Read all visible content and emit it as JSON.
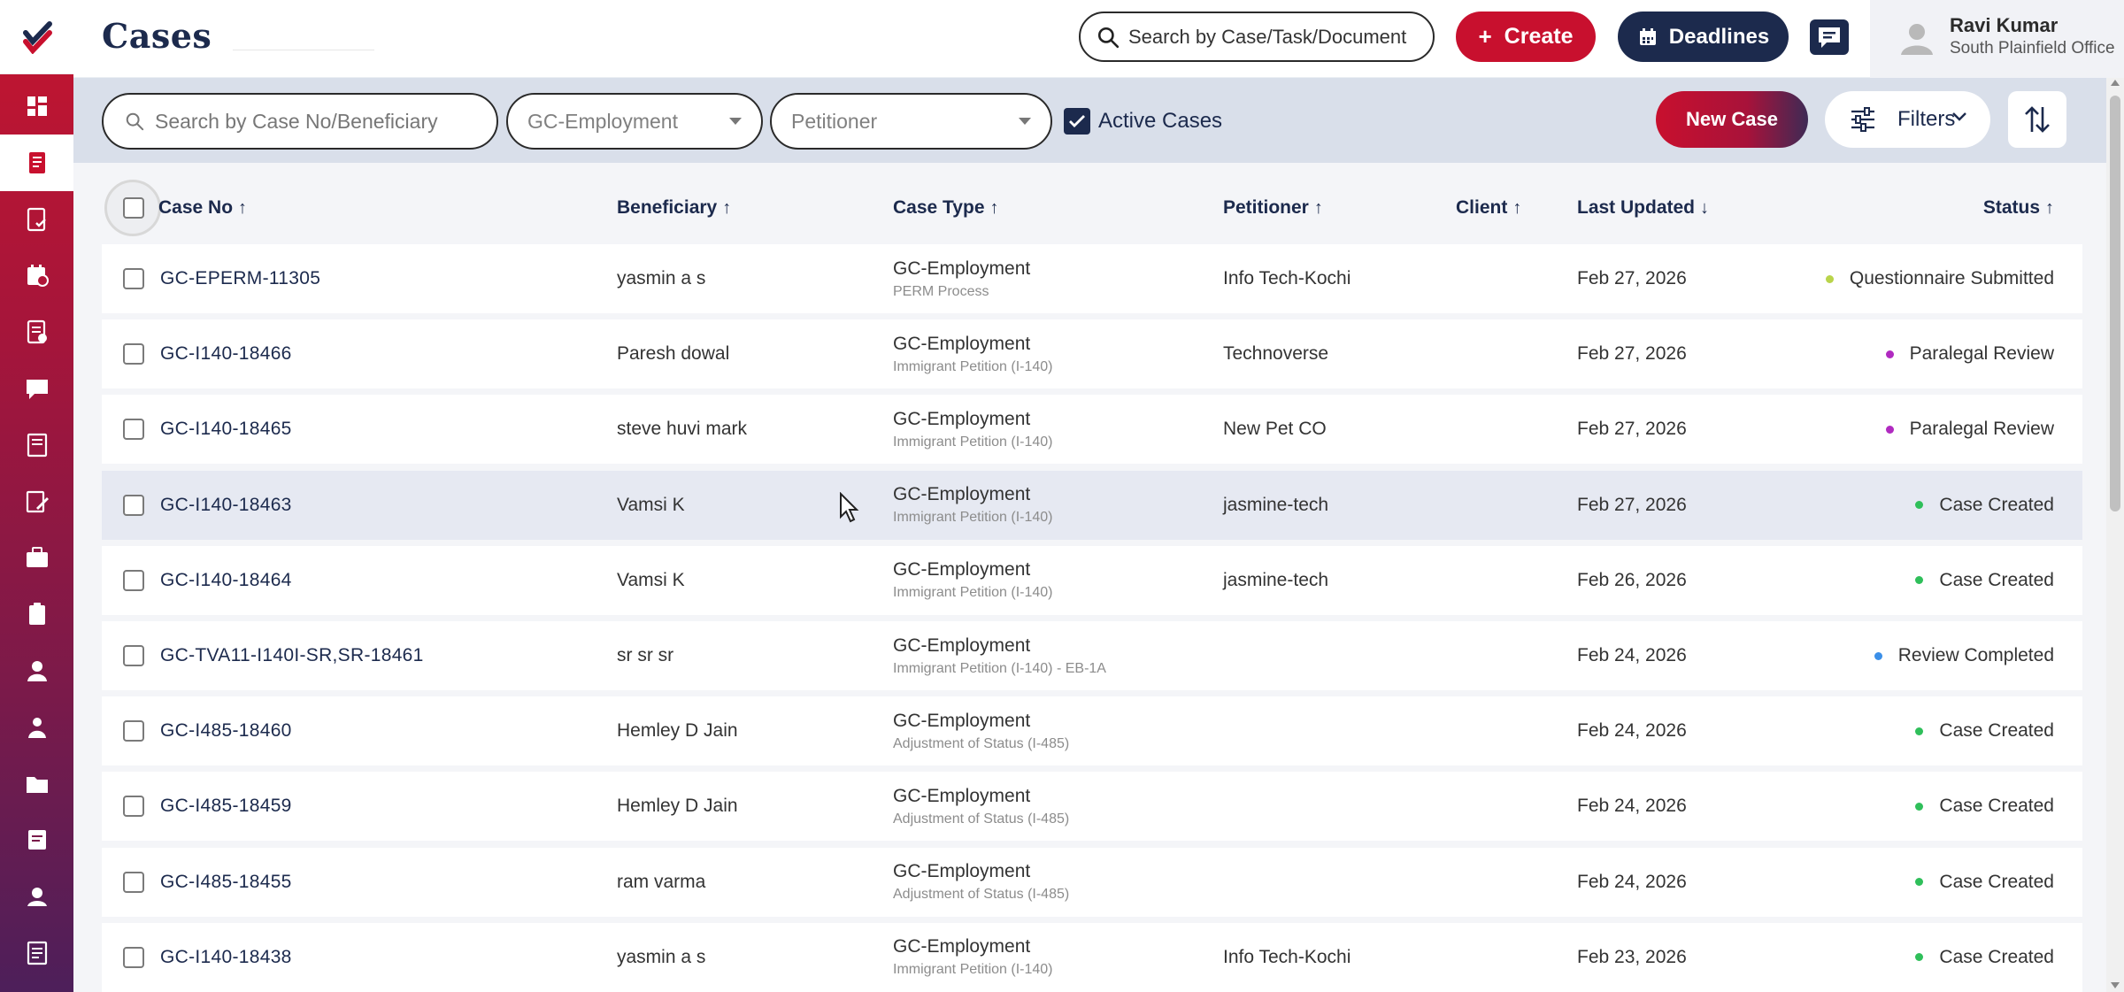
{
  "header": {
    "title": "Cases",
    "search_placeholder": "Search by Case/Task/Document",
    "create_label": "Create",
    "deadlines_label": "Deadlines",
    "user_name": "Ravi Kumar",
    "user_office": "South Plainfield Office"
  },
  "sidebar": {
    "items": [
      {
        "icon": "dashboard-icon"
      },
      {
        "icon": "cases-icon",
        "active": true
      },
      {
        "icon": "document-check-icon"
      },
      {
        "icon": "calendar-icon"
      },
      {
        "icon": "document-list-icon"
      },
      {
        "icon": "chat-icon"
      },
      {
        "icon": "book-icon"
      },
      {
        "icon": "edit-document-icon"
      },
      {
        "icon": "briefcase-icon"
      },
      {
        "icon": "clipboard-icon"
      },
      {
        "icon": "user-icon"
      },
      {
        "icon": "user-group-icon"
      },
      {
        "icon": "folder-icon"
      },
      {
        "icon": "notes-icon"
      },
      {
        "icon": "contact-icon"
      },
      {
        "icon": "reports-icon"
      }
    ]
  },
  "filters": {
    "search_placeholder": "Search by Case No/Beneficiary",
    "case_type_value": "GC-Employment",
    "petitioner_placeholder": "Petitioner",
    "active_cases_label": "Active Cases",
    "active_cases_checked": true,
    "new_case_label": "New Case",
    "filters_label": "Filters"
  },
  "table": {
    "columns": [
      {
        "label": "Case No",
        "sort": "↑"
      },
      {
        "label": "Beneficiary",
        "sort": "↑"
      },
      {
        "label": "Case Type",
        "sort": "↑"
      },
      {
        "label": "Petitioner",
        "sort": "↑"
      },
      {
        "label": "Client",
        "sort": "↑"
      },
      {
        "label": "Last Updated",
        "sort": "↓"
      },
      {
        "label": "Status",
        "sort": "↑"
      }
    ],
    "rows": [
      {
        "case_no": "GC-EPERM-11305",
        "beneficiary": "yasmin a s",
        "case_type": "GC-Employment",
        "case_subtype": "PERM Process",
        "petitioner": "Info Tech-Kochi",
        "client": "",
        "last_updated": "Feb 27, 2026",
        "status": "Questionnaire Submitted",
        "status_color": "#b9d44a"
      },
      {
        "case_no": "GC-I140-18466",
        "beneficiary": "Paresh dowal",
        "case_type": "GC-Employment",
        "case_subtype": "Immigrant Petition (I-140)",
        "petitioner": "Technoverse",
        "client": "",
        "last_updated": "Feb 27, 2026",
        "status": "Paralegal Review",
        "status_color": "#b02ac0"
      },
      {
        "case_no": "GC-I140-18465",
        "beneficiary": "steve huvi mark",
        "case_type": "GC-Employment",
        "case_subtype": "Immigrant Petition (I-140)",
        "petitioner": "New Pet CO",
        "client": "",
        "last_updated": "Feb 27, 2026",
        "status": "Paralegal Review",
        "status_color": "#b02ac0"
      },
      {
        "case_no": "GC-I140-18463",
        "beneficiary": "Vamsi K",
        "case_type": "GC-Employment",
        "case_subtype": "Immigrant Petition (I-140)",
        "petitioner": "jasmine-tech",
        "client": "",
        "last_updated": "Feb 27, 2026",
        "status": "Case Created",
        "status_color": "#2fbf5a"
      },
      {
        "case_no": "GC-I140-18464",
        "beneficiary": "Vamsi K",
        "case_type": "GC-Employment",
        "case_subtype": "Immigrant Petition (I-140)",
        "petitioner": "jasmine-tech",
        "client": "",
        "last_updated": "Feb 26, 2026",
        "status": "Case Created",
        "status_color": "#2fbf5a"
      },
      {
        "case_no": "GC-TVA11-I140I-SR,SR-18461",
        "beneficiary": "sr sr sr",
        "case_type": "GC-Employment",
        "case_subtype": "Immigrant Petition (I-140) - EB-1A",
        "petitioner": "",
        "client": "",
        "last_updated": "Feb 24, 2026",
        "status": "Review Completed",
        "status_color": "#3b8fe8"
      },
      {
        "case_no": "GC-I485-18460",
        "beneficiary": "Hemley D Jain",
        "case_type": "GC-Employment",
        "case_subtype": "Adjustment of Status (I-485)",
        "petitioner": "",
        "client": "",
        "last_updated": "Feb 24, 2026",
        "status": "Case Created",
        "status_color": "#2fbf5a"
      },
      {
        "case_no": "GC-I485-18459",
        "beneficiary": "Hemley D Jain",
        "case_type": "GC-Employment",
        "case_subtype": "Adjustment of Status (I-485)",
        "petitioner": "",
        "client": "",
        "last_updated": "Feb 24, 2026",
        "status": "Case Created",
        "status_color": "#2fbf5a"
      },
      {
        "case_no": "GC-I485-18455",
        "beneficiary": "ram varma",
        "case_type": "GC-Employment",
        "case_subtype": "Adjustment of Status (I-485)",
        "petitioner": "",
        "client": "",
        "last_updated": "Feb 24, 2026",
        "status": "Case Created",
        "status_color": "#2fbf5a"
      },
      {
        "case_no": "GC-I140-18438",
        "beneficiary": "yasmin a s",
        "case_type": "GC-Employment",
        "case_subtype": "Immigrant Petition (I-140)",
        "petitioner": "Info Tech-Kochi",
        "client": "",
        "last_updated": "Feb 23, 2026",
        "status": "Case Created",
        "status_color": "#2fbf5a"
      }
    ]
  }
}
